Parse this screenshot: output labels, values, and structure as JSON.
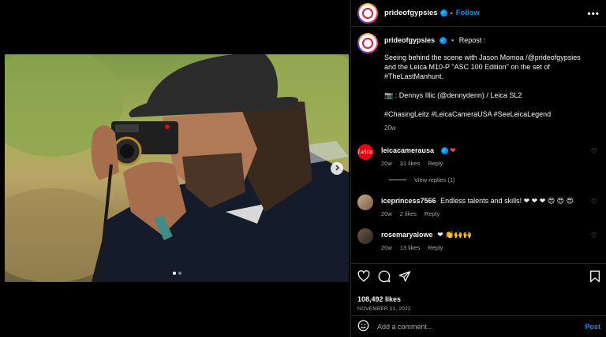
{
  "post": {
    "author": "prideofgypsies",
    "follow_label": "Follow",
    "more_label": "•••",
    "separator": "•",
    "repost_label": "Repost :",
    "caption_lines": [
      "Seeing behind the scene with Jason Momoa /@prideofgypsies",
      "and the Leica M10-P \"ASC 100 Edition\" on the set of",
      "#TheLastManhunt."
    ],
    "credit_line": "📷 : Dennys Illic (@dennydenn) / Leica SL2",
    "hashtags": "#ChasingLeitz #LeicaCameraUSA #SeeLeicaLegend",
    "caption_age": "20w"
  },
  "comments": [
    {
      "user": "leicacamerausa",
      "text": "❤",
      "age": "20w",
      "likes": "31 likes",
      "reply": "Reply",
      "view_replies": "View replies (1)"
    },
    {
      "user": "iceprincess7566",
      "text": "Endless talents and skills! ❤ ❤ ❤ 😍 😍 😍",
      "age": "20w",
      "likes": "2 likes",
      "reply": "Reply"
    },
    {
      "user": "rosemaryalowe",
      "text": "❤ 👏🙌🙌",
      "age": "20w",
      "likes": "13 likes",
      "reply": "Reply"
    }
  ],
  "engagement": {
    "likes": "108,492 likes",
    "date": "NOVEMBER 21, 2022"
  },
  "composer": {
    "placeholder": "Add a comment...",
    "post_label": "Post"
  },
  "carousel": {
    "current": 1,
    "total": 2
  },
  "colors": {
    "accent": "#0095f6",
    "like": "#ed4956",
    "leica_red": "#e20612"
  }
}
